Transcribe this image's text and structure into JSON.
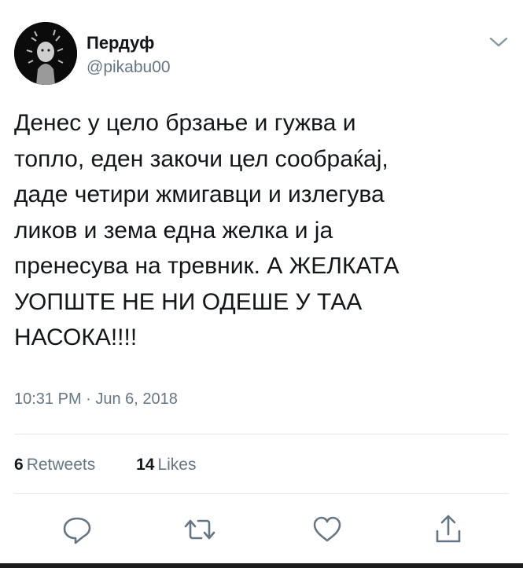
{
  "user": {
    "display_name": "Пердуф",
    "handle": "@pikabu00",
    "avatar_icon": "avatar-image",
    "menu_icon": "chevron-down-icon"
  },
  "tweet": {
    "lines": [
      "Денес у цело брзање и гужва и",
      "топло, еден закочи цел сообраќај,",
      "даде четири жмигавци и излегува",
      "ликов и зема една желка и ја",
      "пренесува на тревник. А ЖЕЛКАТА",
      "УОПШТЕ НЕ НИ ОДЕШЕ У ТАА",
      "НАСОКА!!!!"
    ],
    "timestamp": "10:31 PM · Jun 6, 2018"
  },
  "stats": {
    "retweets_count": "6",
    "retweets_label": "Retweets",
    "likes_count": "14",
    "likes_label": "Likes"
  },
  "actions": {
    "reply_icon": "reply-icon",
    "retweet_icon": "retweet-icon",
    "like_icon": "heart-icon",
    "share_icon": "share-icon"
  },
  "colors": {
    "text": "#14171a",
    "secondary": "#657786",
    "divider": "#e1e8ed"
  }
}
